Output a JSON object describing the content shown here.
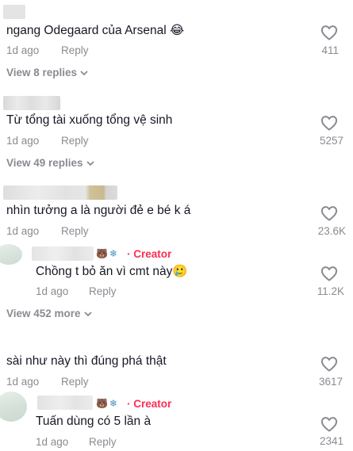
{
  "colors": {
    "accent": "#fe2c55",
    "muted": "#8a8b91",
    "text": "#161823"
  },
  "comments": [
    {
      "text": "ngang Odegaard của Arsenal 😂",
      "time": "1d ago",
      "reply_label": "Reply",
      "likes": "411",
      "view_replies": "View 8 replies"
    },
    {
      "text": "Từ tổng tài xuống tổng vệ sinh",
      "time": "1d ago",
      "reply_label": "Reply",
      "likes": "5257",
      "view_replies": "View 49 replies"
    },
    {
      "text": "nhìn tưởng a là người đẻ e bé k á",
      "time": "1d ago",
      "reply_label": "Reply",
      "likes": "23.6K",
      "creator_reply": {
        "creator_label": "· Creator",
        "text": "Chồng t bỏ ăn vì cmt này🥲",
        "time": "1d ago",
        "reply_label": "Reply",
        "likes": "11.2K"
      },
      "view_replies": "View 452 more"
    },
    {
      "text": "sài như này thì đúng phá thật",
      "time": "1d ago",
      "reply_label": "Reply",
      "likes": "3617",
      "creator_reply": {
        "creator_label": "· Creator",
        "text": "Tuấn dùng có 5 lần à",
        "time": "1d ago",
        "reply_label": "Reply",
        "likes": "2341"
      }
    }
  ],
  "icons": {
    "like": "heart-outline-icon",
    "expand": "chevron-down-icon",
    "badge_bear": "bear-emoji",
    "badge_snow": "snowflake-emoji"
  }
}
